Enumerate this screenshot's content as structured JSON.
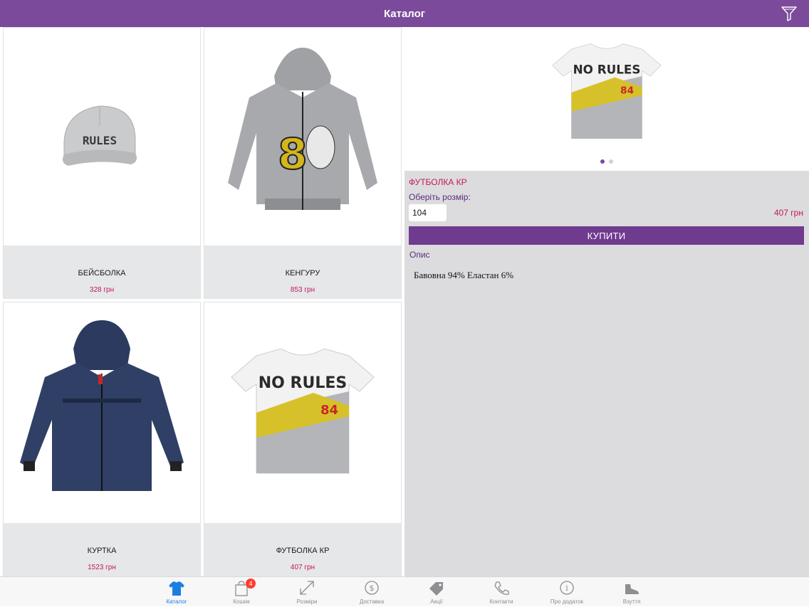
{
  "header": {
    "title": "Каталог"
  },
  "products": [
    {
      "name": "БЕЙСБОЛКА",
      "price": "328 грн"
    },
    {
      "name": "КЕНГУРУ",
      "price": "853 грн"
    },
    {
      "name": "КУРТКА",
      "price": "1523 грн"
    },
    {
      "name": "ФУТБОЛКА КР",
      "price": "407 грн"
    }
  ],
  "detail": {
    "title": "ФУТБОЛКА КР",
    "size_label": "Оберіть розмір:",
    "size_value": "104",
    "price": "407 грн",
    "buy_label": "КУПИТИ",
    "desc_label": "Опис",
    "desc_text": "Бавовна 94% Еластан 6%",
    "image_count": 2,
    "active_image": 1
  },
  "tabs": [
    {
      "label": "Каталог",
      "icon": "shirt-icon",
      "active": true
    },
    {
      "label": "Кошик",
      "icon": "bag-icon",
      "badge": "4"
    },
    {
      "label": "Розміри",
      "icon": "resize-icon"
    },
    {
      "label": "Доставка",
      "icon": "delivery-icon"
    },
    {
      "label": "Акції",
      "icon": "tag-icon"
    },
    {
      "label": "Контакти",
      "icon": "phone-icon"
    },
    {
      "label": "Про додаток",
      "icon": "info-icon"
    },
    {
      "label": "Взуття",
      "icon": "shoe-icon"
    }
  ],
  "colors": {
    "accent": "#7b4a9b",
    "price": "#c2185b",
    "tab_active": "#1a7fe0"
  }
}
